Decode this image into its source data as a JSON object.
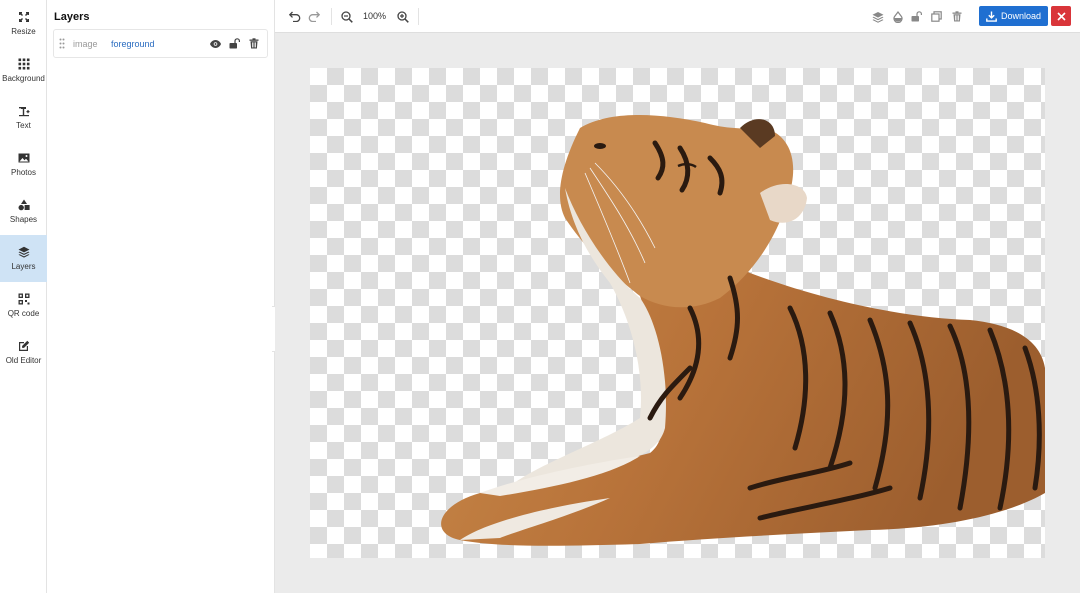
{
  "sidebar": {
    "items": [
      {
        "label": "Resize",
        "icon": "resize-icon",
        "active": false
      },
      {
        "label": "Background",
        "icon": "grid-dots-icon",
        "active": false
      },
      {
        "label": "Text",
        "icon": "text-icon",
        "active": false
      },
      {
        "label": "Photos",
        "icon": "photo-icon",
        "active": false
      },
      {
        "label": "Shapes",
        "icon": "shapes-icon",
        "active": false
      },
      {
        "label": "Layers",
        "icon": "layers-icon",
        "active": true
      },
      {
        "label": "QR code",
        "icon": "qr-code-icon",
        "active": false
      },
      {
        "label": "Old Editor",
        "icon": "edit-icon",
        "active": false
      }
    ]
  },
  "panel": {
    "title": "Layers",
    "layers": [
      {
        "type": "image",
        "name": "foreground"
      }
    ]
  },
  "toolbar": {
    "zoom": "100%",
    "download_label": "Download"
  },
  "colors": {
    "accent": "#1f6fd1",
    "danger": "#d9353a",
    "active_rail": "#cfe3f5"
  }
}
